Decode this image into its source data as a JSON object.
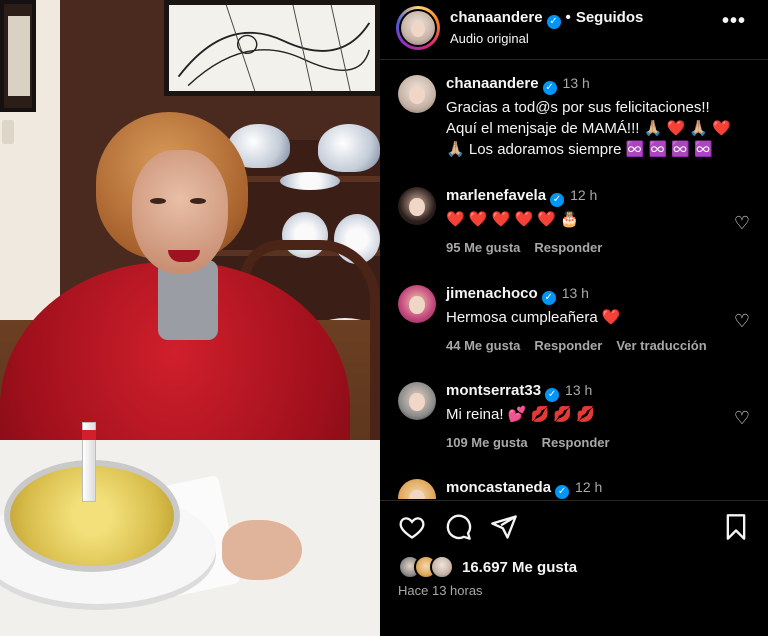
{
  "header": {
    "username": "chanaandere",
    "separator": "•",
    "follow_status": "Seguidos",
    "audio": "Audio original",
    "more": "•••"
  },
  "caption": {
    "username": "chanaandere",
    "time": "13 h",
    "line1": "Gracias a tod@s por sus felicitaciones!!",
    "line2": "Aquí el menjsaje de MAMÁ!!!",
    "line2_emojis": "🙏🏼 ❤️ 🙏🏼 ❤️",
    "line3_emoji": "🙏🏼",
    "line3": "Los adoramos siempre",
    "line3_emojis": "♾️ ♾️ ♾️ ♾️"
  },
  "comments": [
    {
      "username": "marlenefavela",
      "verified": true,
      "time": "12 h",
      "text": "",
      "emojis": "❤️ ❤️ ❤️ ❤️ ❤️ 🎂",
      "likes": "95 Me gusta",
      "reply": "Responder",
      "translate": ""
    },
    {
      "username": "jimenachoco",
      "verified": true,
      "time": "13 h",
      "text": "Hermosa cumpleañera",
      "emojis": "❤️",
      "likes": "44 Me gusta",
      "reply": "Responder",
      "translate": "Ver traducción"
    },
    {
      "username": "montserrat33",
      "verified": true,
      "time": "13 h",
      "text": "Mi reina!",
      "emojis": "💕 💋 💋 💋",
      "likes": "109 Me gusta",
      "reply": "Responder",
      "translate": ""
    },
    {
      "username": "moncastaneda",
      "verified": true,
      "time": "12 h"
    }
  ],
  "footer": {
    "likes": "16.697 Me gusta",
    "posted": "Hace 13 horas"
  },
  "icons": {
    "verified": "✓",
    "heart_outline": "♡"
  },
  "colors": {
    "background": "#000000",
    "text": "#f5f5f5",
    "secondary": "#a8a8a8",
    "verified": "#0095f6"
  }
}
